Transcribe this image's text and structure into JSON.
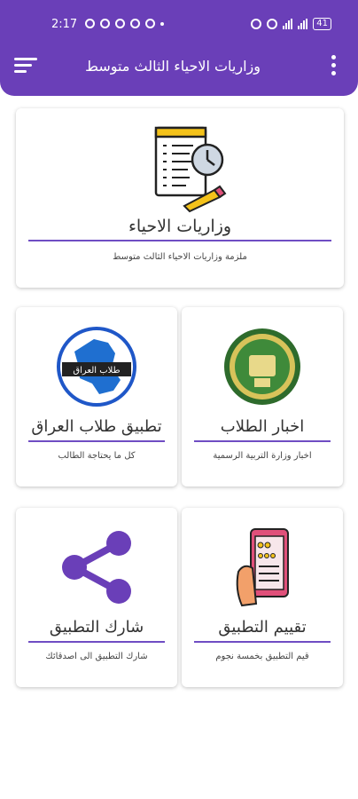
{
  "status_bar": {
    "time": "2:17",
    "battery": "41"
  },
  "app_bar": {
    "title": "وزاريات الاحياء الثالث متوسط"
  },
  "cards": {
    "main": {
      "title": "وزاريات الاحياء",
      "subtitle": "ملزمة وزاريات الاحياء الثالث متوسط",
      "icon": "document-clock-icon"
    },
    "news": {
      "title": "اخبار الطلاب",
      "subtitle": "اخبار وزارة التربية الرسمية",
      "icon": "ministry-seal-icon"
    },
    "iraq": {
      "title": "تطبيق طلاب العراق",
      "subtitle": "كل ما يحتاجة الطالب",
      "icon": "iraq-map-logo-icon",
      "logo_text": "طلاب العراق"
    },
    "rate": {
      "title": "تقييم التطبيق",
      "subtitle": "قيم التطبيق بخمسة نجوم",
      "icon": "phone-rating-icon"
    },
    "share": {
      "title": "شارك التطبيق",
      "subtitle": "شارك التطبيق الى اصدقائك",
      "icon": "share-icon"
    }
  },
  "colors": {
    "primary": "#6a3fb8",
    "accent_rule": "#6f4dc3"
  }
}
